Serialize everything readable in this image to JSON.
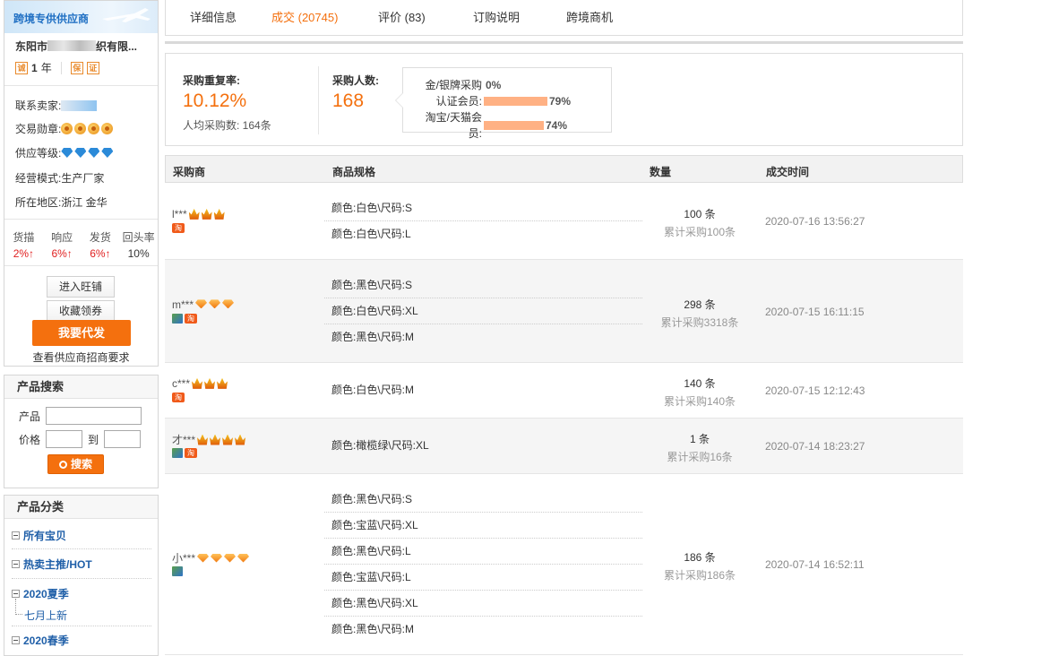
{
  "supplier": {
    "banner": "跨境专供供应商",
    "name_prefix": "东阳市",
    "name_suffix": "织有限...",
    "years": "1",
    "years_unit": "年",
    "contact_label": "联系卖家:",
    "medal_label": "交易勋章:",
    "level_label": "供应等级:",
    "mode_label": "经营模式:",
    "mode_value": "生产厂家",
    "region_label": "所在地区:",
    "region_value": "浙江 金华",
    "stats": [
      {
        "label": "货描",
        "value": "2%↑",
        "kind": "up"
      },
      {
        "label": "响应",
        "value": "6%↑",
        "kind": "up"
      },
      {
        "label": "发货",
        "value": "6%↑",
        "kind": "up"
      },
      {
        "label": "回头率",
        "value": "10%",
        "kind": "neutral"
      }
    ],
    "btn_shop": "进入旺铺",
    "btn_coupon": "收藏领券",
    "btn_dropship": "我要代发",
    "recruit_link": "查看供应商招商要求"
  },
  "search": {
    "title": "产品搜索",
    "product_label": "产品",
    "price_label": "价格",
    "to_label": "到",
    "button": "搜索"
  },
  "categories": {
    "title": "产品分类",
    "items": [
      "所有宝贝",
      "热卖主推/HOT",
      "2020夏季"
    ],
    "subitem": "七月上新",
    "cut_item": "2020春季"
  },
  "tabs": [
    {
      "label": "详细信息",
      "active": false
    },
    {
      "label": "成交 (20745)",
      "active": true
    },
    {
      "label": "评价 (83)",
      "active": false
    },
    {
      "label": "订购说明",
      "active": false
    },
    {
      "label": "跨境商机",
      "active": false
    }
  ],
  "summary": {
    "repeat_label": "采购重复率:",
    "repeat_value": "10.12%",
    "per_person": "人均采购数: 164条",
    "buyers_label": "采购人数:",
    "buyers_value": "168",
    "tip": [
      {
        "label": "金/银牌采购",
        "pct": "0%",
        "fill": 0.0
      },
      {
        "label": "认证会员:",
        "pct": "79%",
        "fill": 0.79
      },
      {
        "label": "淘宝/天猫会员:",
        "pct": "74%",
        "fill": 0.74
      }
    ]
  },
  "table": {
    "headers": [
      "采购商",
      "商品规格",
      "数量",
      "成交时间"
    ],
    "rows": [
      {
        "buyer": "l***",
        "rank": "crown",
        "rank_count": 3,
        "tao": true,
        "verified": false,
        "specs": [
          "颜色:白色\\尺码:S",
          "颜色:白色\\尺码:L"
        ],
        "qty": "100 条",
        "total": "累计采购100条",
        "time": "2020-07-16 13:56:27"
      },
      {
        "buyer": "m***",
        "rank": "heart",
        "rank_count": 3,
        "tao": true,
        "verified": true,
        "specs": [
          "颜色:黑色\\尺码:S",
          "颜色:白色\\尺码:XL",
          "颜色:黑色\\尺码:M"
        ],
        "qty": "298 条",
        "total": "累计采购3318条",
        "time": "2020-07-15 16:11:15"
      },
      {
        "buyer": "c***",
        "rank": "crown",
        "rank_count": 3,
        "tao": true,
        "verified": false,
        "specs": [
          "颜色:白色\\尺码:M"
        ],
        "qty": "140 条",
        "total": "累计采购140条",
        "time": "2020-07-15 12:12:43"
      },
      {
        "buyer": "才***",
        "rank": "crown",
        "rank_count": 4,
        "tao": true,
        "verified": true,
        "specs": [
          "颜色:橄榄绿\\尺码:XL"
        ],
        "qty": "1 条",
        "total": "累计采购16条",
        "time": "2020-07-14 18:23:27"
      },
      {
        "buyer": "小***",
        "rank": "heart",
        "rank_count": 4,
        "tao": false,
        "verified": true,
        "specs": [
          "颜色:黑色\\尺码:S",
          "颜色:宝蓝\\尺码:XL",
          "颜色:黑色\\尺码:L",
          "颜色:宝蓝\\尺码:L",
          "颜色:黑色\\尺码:XL",
          "颜色:黑色\\尺码:M"
        ],
        "qty": "186 条",
        "total": "累计采购186条",
        "time": "2020-07-14 16:52:11"
      }
    ]
  }
}
